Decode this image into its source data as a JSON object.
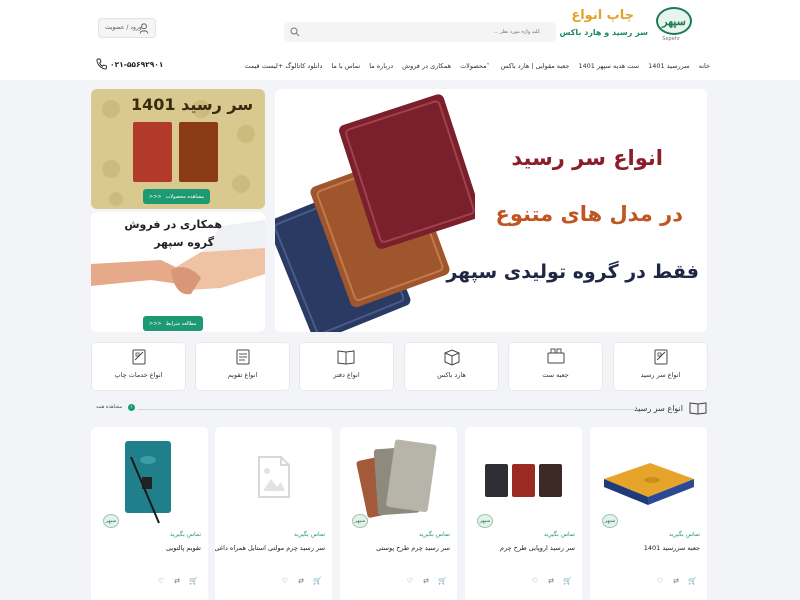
{
  "header": {
    "logo_text": "سپهر",
    "logo_sub": "Sepehr",
    "brand_title": "چاپ انواع",
    "brand_sub": "سر رسید و هارد باکس",
    "search_placeholder": "کلید واژه مورد نظر ...",
    "login_label": "ورود / عضویت"
  },
  "nav": {
    "items": [
      "خانه",
      "سررسید 1401",
      "ست هدیه سپهر 1401",
      "جعبه مقوایی | هارد باکس",
      "محصولات",
      "همکاری در فروش",
      "درباره ما",
      "تماس با ما",
      "دانلود کاتالوگ +لیست قیمت"
    ],
    "phone": "۰۲۱-۵۵۶۹۲۹۰۱"
  },
  "hero": {
    "line1": "انواع سر رسید",
    "line2": "در مدل های متنوع",
    "line3": "فقط در گروه تولیدی سپهر"
  },
  "side_banners": {
    "banner1_title": "سر رسید 1401",
    "banner1_button": "مشاهده محصولات",
    "banner2_line1": "همکاری در فروش",
    "banner2_line2": "گروه سپهر",
    "banner2_button": "مطالعه شرایط",
    "arrows": ">>>"
  },
  "categories": [
    {
      "label": "انواع سر رسید",
      "icon": "print-icon"
    },
    {
      "label": "جعبه ست",
      "icon": "box-set-icon"
    },
    {
      "label": "هارد باکس",
      "icon": "hard-box-icon"
    },
    {
      "label": "انواع دفتر",
      "icon": "notebook-icon"
    },
    {
      "label": "انواع تقویم",
      "icon": "calendar-icon"
    },
    {
      "label": "انواع خدمات چاپ",
      "icon": "print-services-icon"
    }
  ],
  "section": {
    "title": "انواع سر رسید",
    "view_all": "مشاهده همه"
  },
  "products": [
    {
      "price": "تماس بگیرید",
      "name": "جعبه سررسید 1401"
    },
    {
      "price": "تماس بگیرید",
      "name": "سر رسید اروپایی طرح چرم"
    },
    {
      "price": "تماس بگیرید",
      "name": "سر رسید چرم طرح پوستی"
    },
    {
      "price": "تماس بگیرید",
      "name": "سر رسید چرم مولتی استایل همراه داغی"
    },
    {
      "price": "تماس بگیرید",
      "name": "تقویم پالتویی"
    }
  ],
  "colors": {
    "accent": "#1e9a72",
    "brand_gold": "#e0a42a",
    "hero_red": "#8b1e2a",
    "hero_orange": "#c0561f",
    "hero_navy": "#1e2744"
  }
}
